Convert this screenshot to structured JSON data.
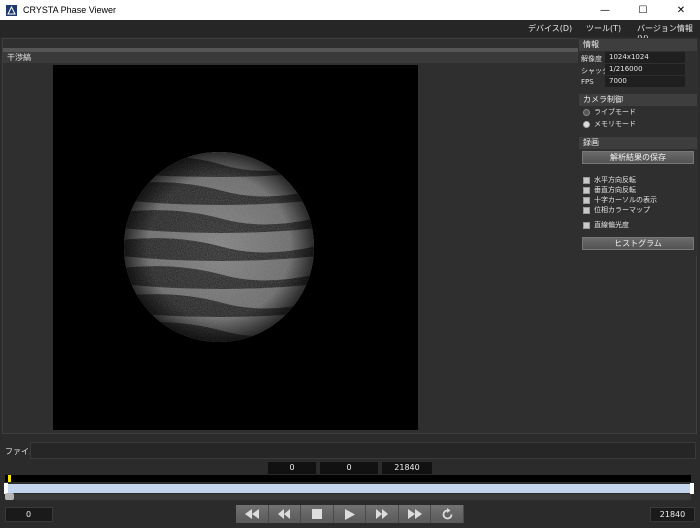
{
  "window": {
    "title": "CRYSTA Phase Viewer",
    "minimize": "—",
    "maximize": "☐",
    "close": "✕"
  },
  "menu": {
    "items": [
      "デバイス(D)",
      "ツール(T)",
      "バージョン情報(V)"
    ]
  },
  "view": {
    "panel_title": "干渉縞"
  },
  "info": {
    "header": "情報",
    "resolution_label": "解像度",
    "resolution_value": "1024x1024",
    "shutter_label": "シャッター",
    "shutter_value": "1/216000",
    "fps_label": "FPS",
    "fps_value": "7000"
  },
  "camera": {
    "header": "カメラ制御",
    "live_mode": "ライブモード",
    "memory_mode": "メモリモード",
    "selected": "memory"
  },
  "record": {
    "header": "録画",
    "save_button": "解析結果の保存"
  },
  "options": {
    "flip_horizontal": "水平方向反転",
    "flip_vertical": "垂直方向反転",
    "cross_cursor": "十字カーソルの表示",
    "phase_colormap": "位相カラーマップ",
    "linear_polarization": "直線偏光度",
    "histogram_button": "ヒストグラム"
  },
  "file": {
    "label": "ファイル :",
    "value": ""
  },
  "counters": {
    "a": "0",
    "b": "0",
    "c": "21840"
  },
  "playback": {
    "start": "0",
    "end": "21840",
    "marker_fraction": 0.004
  },
  "colors": {
    "accent_marker": "#f4e400",
    "slider_track": "#c2d4ee",
    "background": "#2b2b2b"
  }
}
